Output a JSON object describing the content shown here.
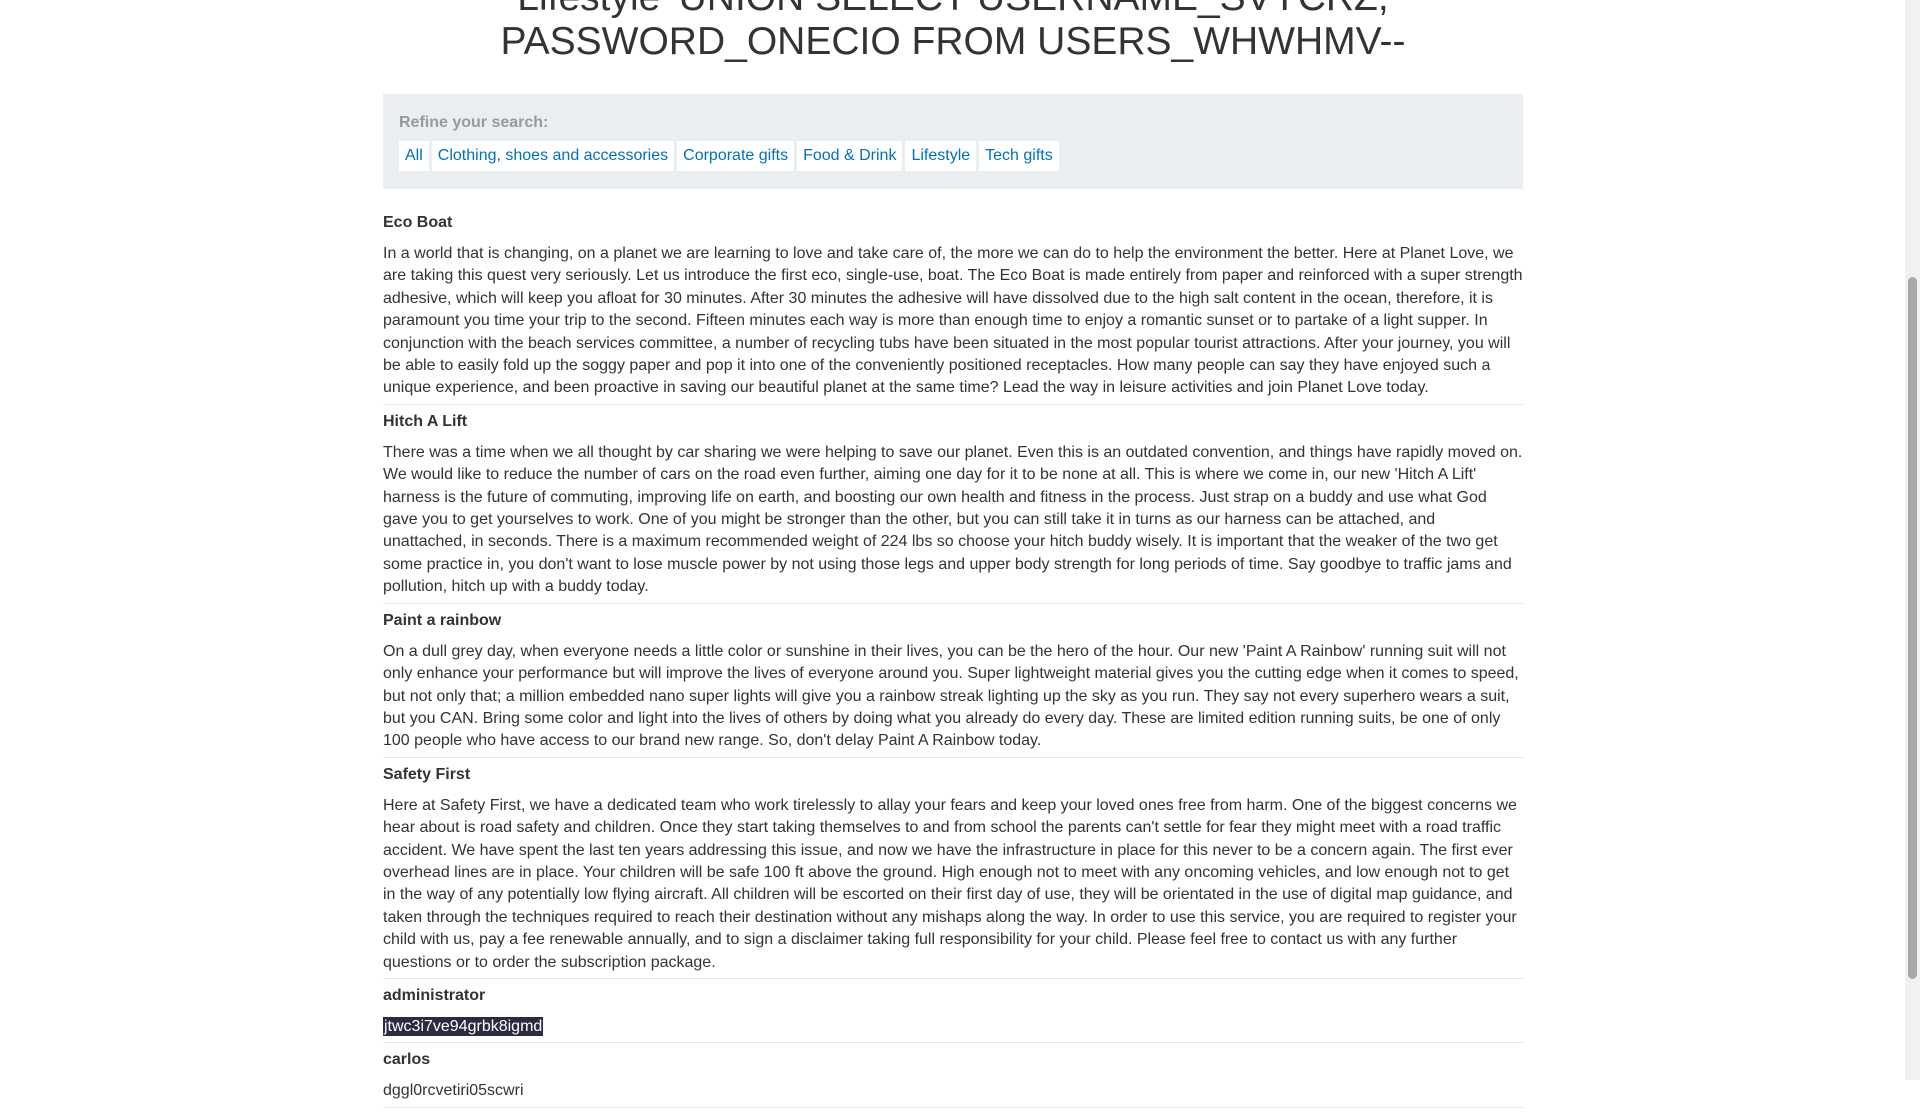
{
  "header": {
    "title_line1": "Lifestyle' UNION SELECT USERNAME_SVYCRZ,",
    "title_line2": "PASSWORD_ONECIO FROM USERS_WHWHMV--"
  },
  "filters": {
    "label": "Refine your search:",
    "links": [
      "All",
      "Clothing, shoes and accessories",
      "Corporate gifts",
      "Food & Drink",
      "Lifestyle",
      "Tech gifts"
    ]
  },
  "results": [
    {
      "title": "Eco Boat",
      "body": "In a world that is changing, on a planet we are learning to love and take care of, the more we can do to help the environment the better. Here at Planet Love, we are taking this quest very seriously. Let us introduce the first eco, single-use, boat. The Eco Boat is made entirely from paper and reinforced with a super strength adhesive, which will keep you afloat for 30 minutes. After 30 minutes the adhesive will have dissolved due to the high salt content in the ocean, therefore, it is paramount you time your trip to the second. Fifteen minutes each way is more than enough time to enjoy a romantic sunset or to partake of a light supper. In conjunction with the beach services committee, a number of recycling tubs have been situated in the most popular tourist attractions. After your journey, you will be able to easily fold up the soggy paper and pop it into one of the conveniently positioned receptacles. How many people can say they have enjoyed such a unique experience, and been proactive in saving our beautiful planet at the same time? Lead the way in leisure activities and join Planet Love today."
    },
    {
      "title": "Hitch A Lift",
      "body": "There was a time when we all thought by car sharing we were helping to save our planet. Even this is an outdated convention, and things have rapidly moved on. We would like to reduce the number of cars on the road even further, aiming one day for it to be none at all. This is where we come in, our new 'Hitch A Lift' harness is the future of commuting, improving life on earth, and boosting our own health and fitness in the process. Just strap on a buddy and use what God gave you to get yourselves to work. One of you might be stronger than the other, but you can still take it in turns as our harness can be attached, and unattached, in seconds. There is a maximum recommended weight of 224 lbs so choose your hitch buddy wisely. It is important that the weaker of the two get some practice in, you don't want to lose muscle power by not using those legs and upper body strength for long periods of time. Say goodbye to traffic jams and pollution, hitch up with a buddy today."
    },
    {
      "title": "Paint a rainbow",
      "body": "On a dull grey day, when everyone needs a little color or sunshine in their lives, you can be the hero of the hour. Our new 'Paint A Rainbow' running suit will not only enhance your performance but will improve the lives of everyone around you. Super lightweight material gives you the cutting edge when it comes to speed, but not only that; a million embedded nano super lights will give you a rainbow streak lighting up the sky as you run. They say not every superhero wears a suit, but you CAN. Bring some color and light into the lives of others by doing what you already do every day. These are limited edition running suits, be one of only 100 people who have access to our brand new range. So, don't delay Paint A Rainbow today."
    },
    {
      "title": "Safety First",
      "body": "Here at Safety First, we have a dedicated team who work tirelessly to allay your fears and keep your loved ones free from harm. One of the biggest concerns we hear about is road safety and children. Once they start taking themselves to and from school the parents can't settle for fear they might meet with a road traffic accident. We have spent the last ten years addressing this issue, and now we have the infrastructure in place for this never to be a concern again. The first ever overhead lines are in place. Your children will be safe 100 ft above the ground. High enough not to meet with any oncoming vehicles, and low enough not to get in the way of any potentially low flying aircraft. All children will be escorted on their first day of use, they will be orientated in the use of digital map guidance, and taken through the techniques required to reach their destination without any mishaps along the way. In order to use this service, you are required to register your child with us, pay a fee renewable annually, and to sign a disclaimer taking full responsibility for your child. Please feel free to contact us with any further questions or to order the subscription package."
    },
    {
      "title": "administrator",
      "body": "jtwc3i7ve94grbk8igmd",
      "selected": true
    },
    {
      "title": "carlos",
      "body": "dggl0rcvetiri05scwri"
    }
  ]
}
